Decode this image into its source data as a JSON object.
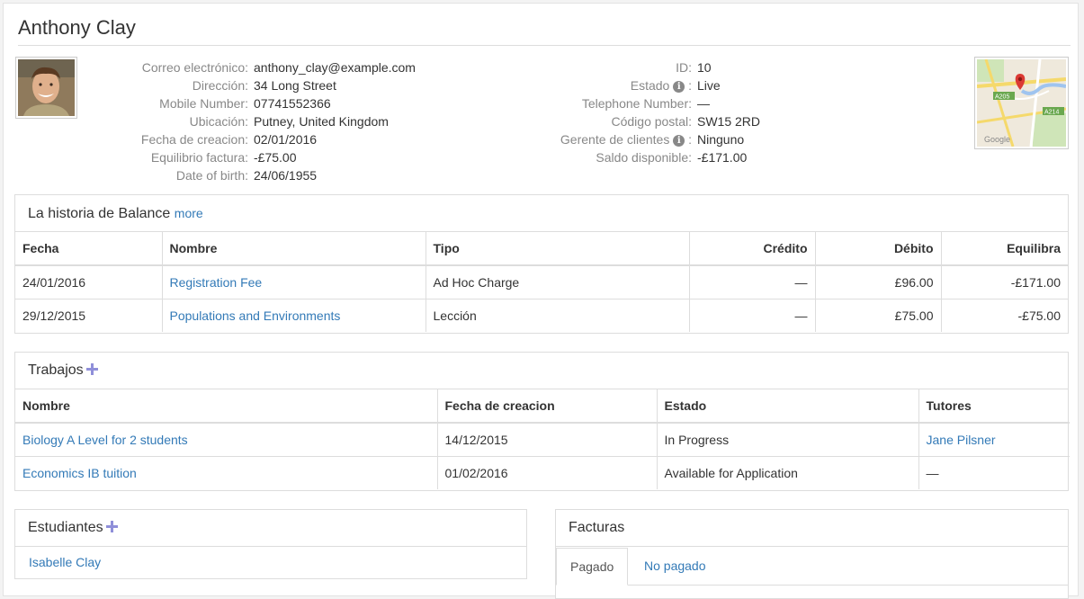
{
  "contact": {
    "name": "Anthony Clay",
    "left_fields": [
      {
        "label": "Correo electrónico:",
        "value": "anthony_clay@example.com",
        "link": true
      },
      {
        "label": "Dirección:",
        "value": "34 Long Street"
      },
      {
        "label": "Mobile Number:",
        "value": "07741552366"
      },
      {
        "label": "Ubicación:",
        "value": "Putney, United Kingdom"
      },
      {
        "label": "Fecha de creacion:",
        "value": "02/01/2016"
      },
      {
        "label": "Equilibrio factura:",
        "value": "-£75.00"
      },
      {
        "label": "Date of birth:",
        "value": "24/06/1955"
      }
    ],
    "right_fields": [
      {
        "label": "ID:",
        "value": "10"
      },
      {
        "label": "Estado",
        "value": "Live",
        "info": true
      },
      {
        "label": "Telephone Number:",
        "value": "—"
      },
      {
        "label": "Código postal:",
        "value": "SW15 2RD"
      },
      {
        "label": "Gerente de clientes",
        "value": "Ninguno",
        "info": true
      },
      {
        "label": "Saldo disponible:",
        "value": "-£171.00"
      }
    ],
    "map": {
      "road_a205": "A205",
      "road_a214": "A214",
      "map_logo": "Google"
    }
  },
  "balance_history": {
    "title": "La historia de Balance",
    "more_link": "more",
    "columns": [
      "Fecha",
      "Nombre",
      "Tipo",
      "Crédito",
      "Débito",
      "Equilibra"
    ],
    "rows": [
      [
        "24/01/2016",
        "Registration Fee",
        "Ad Hoc Charge",
        "—",
        "£96.00",
        "-£171.00"
      ],
      [
        "29/12/2015",
        "Populations and Environments",
        "Lección",
        "—",
        "£75.00",
        "-£75.00"
      ]
    ]
  },
  "jobs": {
    "title": "Trabajos",
    "add_icon": "plus-icon",
    "columns": [
      "Nombre",
      "Fecha de creacion",
      "Estado",
      "Tutores"
    ],
    "rows": [
      [
        "Biology A Level for 2 students",
        "14/12/2015",
        "In Progress",
        "Jane Pilsner"
      ],
      [
        "Economics IB tuition",
        "01/02/2016",
        "Available for Application",
        "—"
      ]
    ]
  },
  "students": {
    "title": "Estudiantes",
    "add_icon": "plus-icon",
    "items": [
      "Isabelle Clay"
    ]
  },
  "invoices": {
    "title": "Facturas",
    "tabs": [
      "Pagado",
      "No pagado"
    ],
    "active_tab": "Pagado"
  },
  "colors": {
    "link": "#337ab7",
    "plus_icon": "#8f8fd9",
    "map_pin": "#db3a34"
  }
}
